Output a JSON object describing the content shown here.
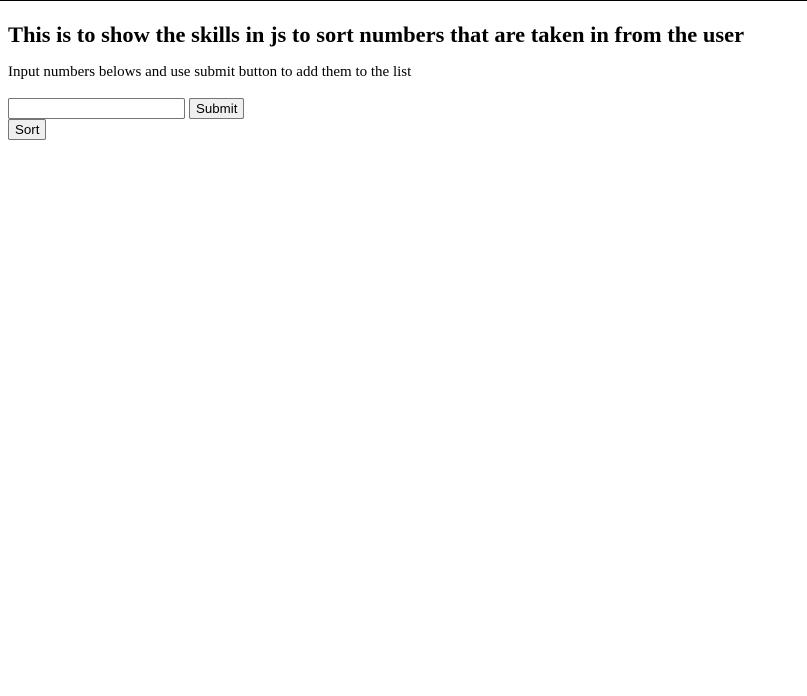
{
  "page": {
    "heading": "This is to show the skills in js to sort numbers that are taken in from the user",
    "instructions": "Input numbers belows and use submit button to add them to the list"
  },
  "form": {
    "number_input_value": "",
    "number_input_placeholder": "",
    "submit_label": "Submit",
    "sort_label": "Sort"
  }
}
